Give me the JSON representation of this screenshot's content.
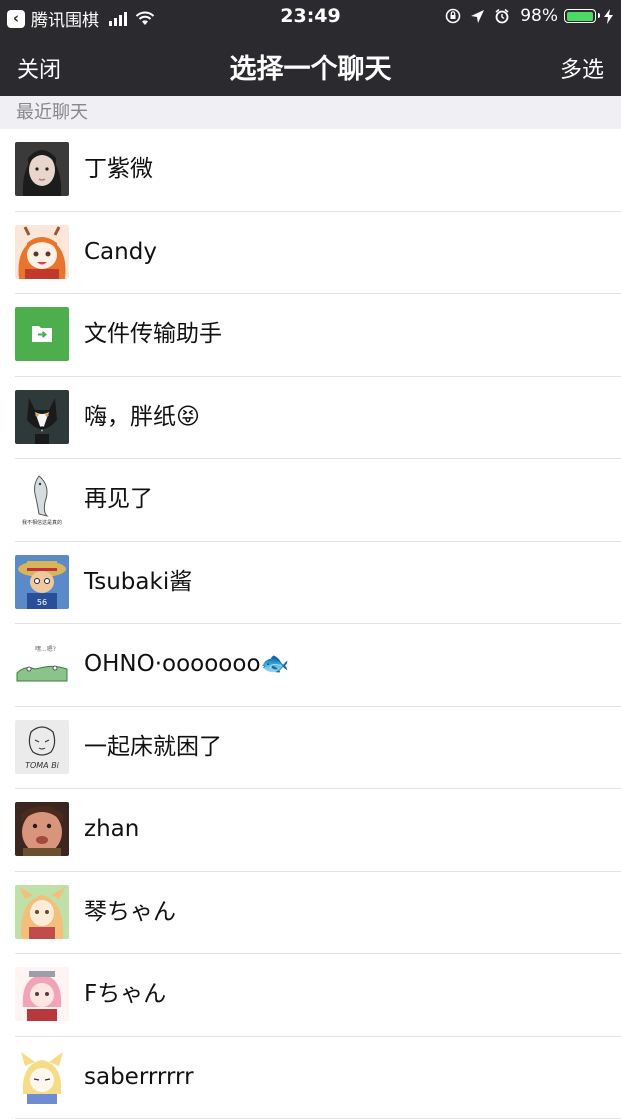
{
  "status_bar": {
    "back_app": "腾讯围棋",
    "time": "23:49",
    "battery_percent": "98%",
    "battery_level": 0.98,
    "icons": [
      "back-arrow-icon",
      "signal-icon",
      "wifi-icon",
      "orientation-lock-icon",
      "location-icon",
      "alarm-icon",
      "battery-icon",
      "charging-icon"
    ]
  },
  "nav": {
    "close_label": "关闭",
    "title": "选择一个聊天",
    "multi_label": "多选"
  },
  "section": {
    "recent_label": "最近聊天"
  },
  "chats": [
    {
      "name": "丁紫微",
      "avatar": "photo-girl"
    },
    {
      "name": "Candy",
      "avatar": "anime-girl-orange"
    },
    {
      "name": "文件传输助手",
      "avatar": "file-transfer-icon"
    },
    {
      "name": "嗨，胖纸😝",
      "avatar": "husky-dog"
    },
    {
      "name": "再见了",
      "avatar": "fish-sketch",
      "avatar_caption": "我不相信这是真的"
    },
    {
      "name": "Tsubaki酱",
      "avatar": "luffy-anime"
    },
    {
      "name": "OHNO·ooooooo🐟",
      "avatar": "crocodile-doodle"
    },
    {
      "name": "一起床就困了",
      "avatar": "sketch-drawing",
      "avatar_caption": "TOMA Bi"
    },
    {
      "name": "zhan",
      "avatar": "photo-baby"
    },
    {
      "name": "琴ちゃん",
      "avatar": "anime-fox-girl"
    },
    {
      "name": "Fちゃん",
      "avatar": "anime-pink-girl"
    },
    {
      "name": "saberrrrrr",
      "avatar": "anime-blonde-girl"
    }
  ],
  "colors": {
    "bar_background": "#2b2b2f",
    "section_background": "#efeff4",
    "file_transfer_green": "#4cae4c",
    "battery_green": "#4cd964"
  }
}
